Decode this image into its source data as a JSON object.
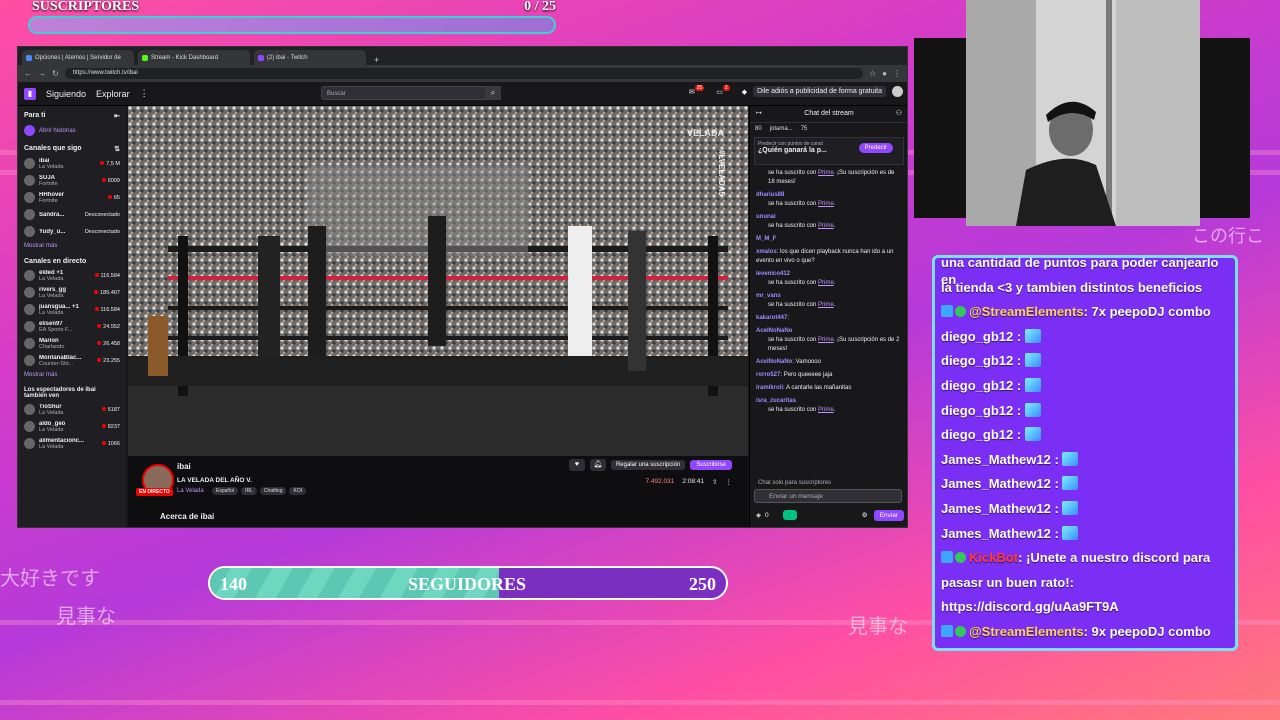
{
  "overlay": {
    "subs_label": "SUSCRIPTORES",
    "subs_count": "0  / 25",
    "followers_label": "SEGUIDORES",
    "followers_current": "140",
    "followers_goal": "250",
    "followers_progress": 0.56,
    "bg_text_1": "大好きです",
    "bg_text_2": "見事な",
    "bg_text_3": "見事な",
    "bg_text_4": "この行こ"
  },
  "browser": {
    "tabs": [
      {
        "label": "Opciones | Atemos | Servidor de",
        "color": "#4a8cff"
      },
      {
        "label": "Stream - Kick Dashboard",
        "color": "#53fc18"
      },
      {
        "label": "(2) ibai - Twitch",
        "color": "#9146ff"
      }
    ],
    "url": "https://www.twitch.tv/ibai"
  },
  "twitch": {
    "nav_following": "Siguiendo",
    "nav_explore": "Explorar",
    "search_placeholder": "Buscar",
    "badge_1": "25",
    "badge_2": "2",
    "turbo": "Dile adiós a publicidad de forma gratuita",
    "sidenav": {
      "for_you": "Para ti",
      "open_stories": "Abrir historias",
      "followed_title": "Canales que sigo",
      "followed": [
        {
          "name": "ibai",
          "sub": "La Velada",
          "viewers": "7,5 M"
        },
        {
          "name": "SUJA",
          "sub": "Fortnite",
          "viewers": "6009"
        },
        {
          "name": "HHhover",
          "sub": "Fortnite",
          "viewers": "65"
        },
        {
          "name": "Sandra...",
          "sub": "",
          "viewers": "Desconectado"
        },
        {
          "name": "Yudy_u...",
          "sub": "",
          "viewers": "Desconectado"
        }
      ],
      "show_more": "Mostrar más",
      "live_title": "Canales en directo",
      "live": [
        {
          "name": "elded +1",
          "sub": "La Velada",
          "viewers": "116.584"
        },
        {
          "name": "rivers_gg",
          "sub": "La Velada",
          "viewers": "185.407"
        },
        {
          "name": "juansgua... +1",
          "sub": "La Velada",
          "viewers": "116.584"
        },
        {
          "name": "elisen97",
          "sub": "EA Sports F...",
          "viewers": "24.552"
        },
        {
          "name": "Marion",
          "sub": "Charlando",
          "viewers": "26.458"
        },
        {
          "name": "MontanaBlac...",
          "sub": "Counter-Stri...",
          "viewers": "23.255"
        }
      ],
      "show_more_2": "Mostrar más",
      "viewers_title": "Los espectadores de ibai también ven",
      "also": [
        {
          "name": "TioShur",
          "sub": "La Velada",
          "viewers": "5187"
        },
        {
          "name": "aldo_geo",
          "sub": "La Velada",
          "viewers": "8237"
        },
        {
          "name": "alimentacionc...",
          "sub": "La Velada",
          "viewers": "1066"
        }
      ]
    },
    "stream": {
      "channel": "ibai",
      "title": "LA VELADA DEL AÑO V.",
      "category": "La Velada",
      "tags": [
        "Español",
        "IRL",
        "Chatting",
        "KOI"
      ],
      "live": "EN DIRECTO",
      "gift": "Regalar una suscripción",
      "subscribe": "Suscribirse",
      "viewers": "7.492.031",
      "uptime": "2:08:41",
      "about": "Acerca de ibai",
      "overlay_watermark": "VELADA",
      "vertical_tag": "#LVELADA5"
    },
    "chat": {
      "title": "Chat del stream",
      "chip1": "80",
      "chip2": "jotama...",
      "chip3": "75",
      "pred_hint": "Predecir con puntos de canal",
      "pred_question": "¿Quién ganará la p...",
      "pred_button": "Predecir",
      "messages": [
        {
          "user": "",
          "text": "se ha suscrito con",
          "link": "Prime",
          "extra": ". ¡Su suscripción es de 18 meses!"
        },
        {
          "user": "dharius88",
          "text": "se ha suscrito con",
          "link": "Prime",
          "extra": "."
        },
        {
          "user": "ununai",
          "text": "se ha suscrito con",
          "link": "Prime",
          "extra": "."
        },
        {
          "user": "M_M_F",
          "text": "",
          "link": "",
          "extra": ""
        },
        {
          "user": "xmalos",
          "text": ": los que dicen playback nunca han ido a un evento en vivo o que?",
          "link": "",
          "extra": ""
        },
        {
          "user": "levenico412",
          "text": "se ha suscrito con",
          "link": "Prime",
          "extra": "."
        },
        {
          "user": "mr_vans",
          "text": "se ha suscrito con",
          "link": "Prime",
          "extra": "."
        },
        {
          "user": "kakarot447",
          "text": ":",
          "link": "",
          "extra": ""
        },
        {
          "user": "AcelNoNaNo",
          "text": "se ha suscrito con",
          "link": "Prime",
          "extra": ". ¡Su suscripción es de 2 meses!"
        },
        {
          "user": "AcelNoNaNo",
          "text": ": Vamoooo",
          "link": "",
          "extra": ""
        },
        {
          "user": "rorro527",
          "text": ": Pero queeeee jaja",
          "link": "",
          "extra": ""
        },
        {
          "user": "iramikroii",
          "text": ": A cantarle las mañanitas",
          "link": "",
          "extra": ""
        },
        {
          "user": "isra_zucaritas",
          "text": "se ha suscrito con",
          "link": "Prime",
          "extra": "."
        }
      ],
      "subs_only": "Chat solo para suscriptores",
      "input_placeholder": "Enviar un mensaje",
      "points": "0",
      "send": "Enviar"
    }
  },
  "overlay_chat": {
    "lines": [
      {
        "kind": "text",
        "text": "una cantidad de puntos para poder canjearlo en"
      },
      {
        "kind": "text",
        "text": "la tienda <3 y tambien distintos beneficios"
      },
      {
        "kind": "bot",
        "user": "@StreamElements",
        "text": ": 7x peepoDJ combo"
      },
      {
        "kind": "emote",
        "user": "diego_gb12",
        "text": " :"
      },
      {
        "kind": "emote",
        "user": "diego_gb12",
        "text": " :"
      },
      {
        "kind": "emote",
        "user": "diego_gb12",
        "text": " :"
      },
      {
        "kind": "emote",
        "user": "diego_gb12",
        "text": " :"
      },
      {
        "kind": "emote",
        "user": "diego_gb12",
        "text": " :"
      },
      {
        "kind": "emote",
        "user": "James_Mathew12",
        "text": " :"
      },
      {
        "kind": "emote",
        "user": "James_Mathew12",
        "text": " :"
      },
      {
        "kind": "emote",
        "user": "James_Mathew12",
        "text": " :"
      },
      {
        "kind": "emote",
        "user": "James_Mathew12",
        "text": " :"
      },
      {
        "kind": "kick",
        "user": "KickBot",
        "text": ": ¡Unete a nuestro discord para"
      },
      {
        "kind": "text",
        "text": "pasasr un buen rato!:"
      },
      {
        "kind": "text",
        "text": "https://discord.gg/uAa9FT9A"
      },
      {
        "kind": "bot",
        "user": "@StreamElements",
        "text": ": 9x peepoDJ combo"
      },
      {
        "kind": "emote",
        "user": "diego_gb12",
        "text": " :"
      }
    ]
  }
}
